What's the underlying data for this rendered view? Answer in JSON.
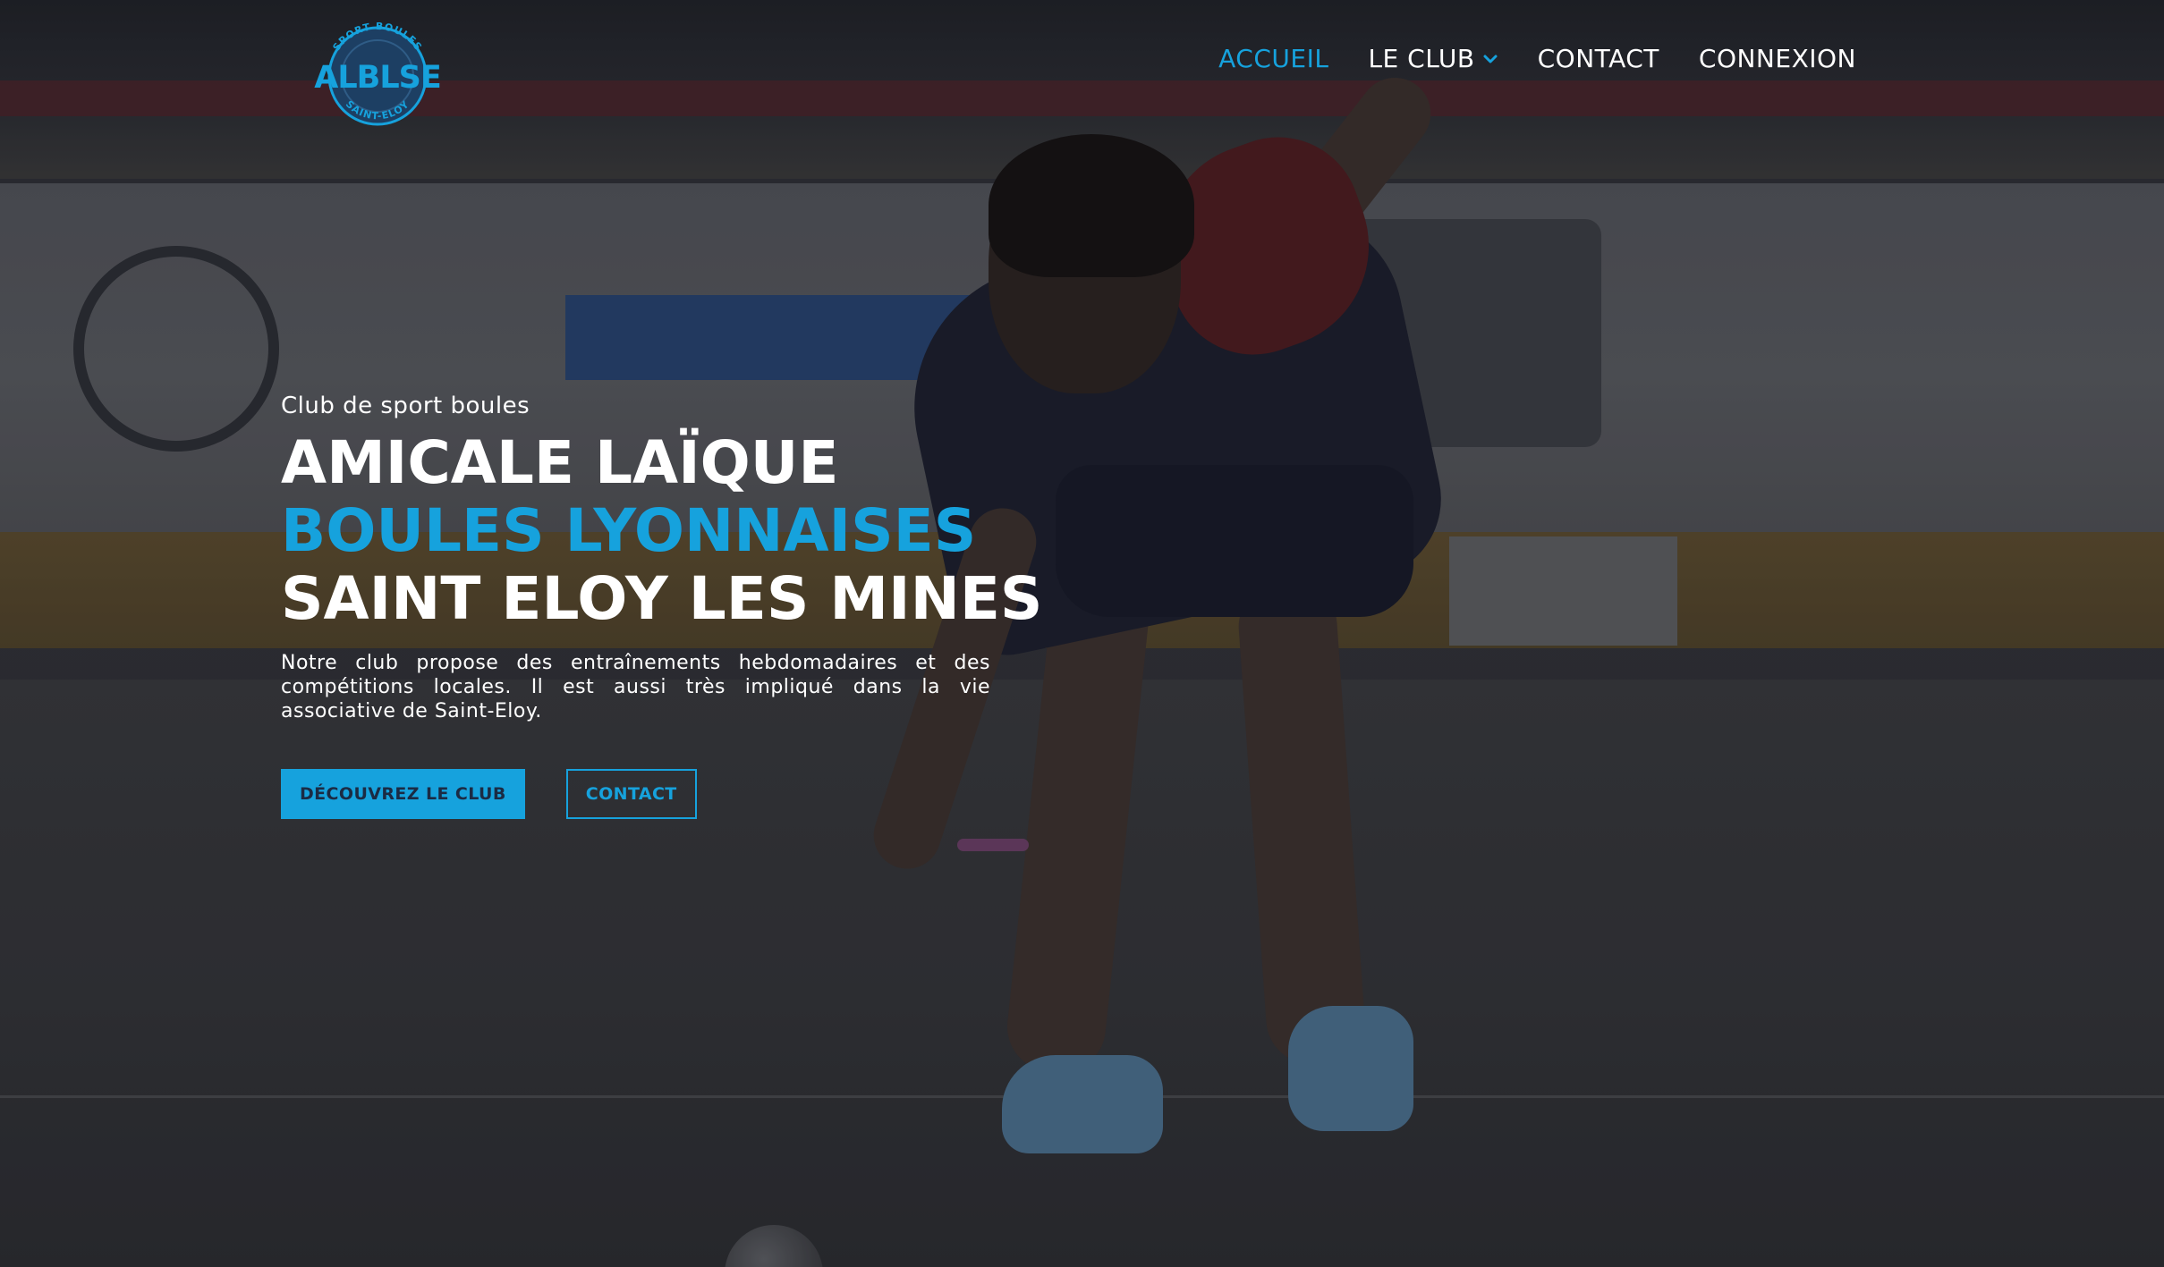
{
  "brand": {
    "logo_text": "ALBLSE",
    "logo_arc_top": "SPORT BOULES",
    "logo_arc_bottom": "SAINT-ELOY",
    "accent_color": "#16a2dd"
  },
  "nav": {
    "items": [
      {
        "label": "ACCUEIL",
        "active": true
      },
      {
        "label": "LE CLUB",
        "has_dropdown": true,
        "icon": "chevron-down-icon"
      },
      {
        "label": "CONTACT"
      },
      {
        "label": "CONNEXION"
      }
    ]
  },
  "hero": {
    "subtitle": "Club de sport boules",
    "title_line1": "AMICALE LAÏQUE",
    "title_line2": "BOULES LYONNAISES",
    "title_line3": "SAINT ELOY LES MINES",
    "description": "Notre club propose des entraînements hebdomadaires et des compétitions locales. Il est aussi très impliqué dans la vie associative de Saint-Eloy.",
    "primary_button": "DÉCOUVREZ LE CLUB",
    "secondary_button": "CONTACT"
  }
}
